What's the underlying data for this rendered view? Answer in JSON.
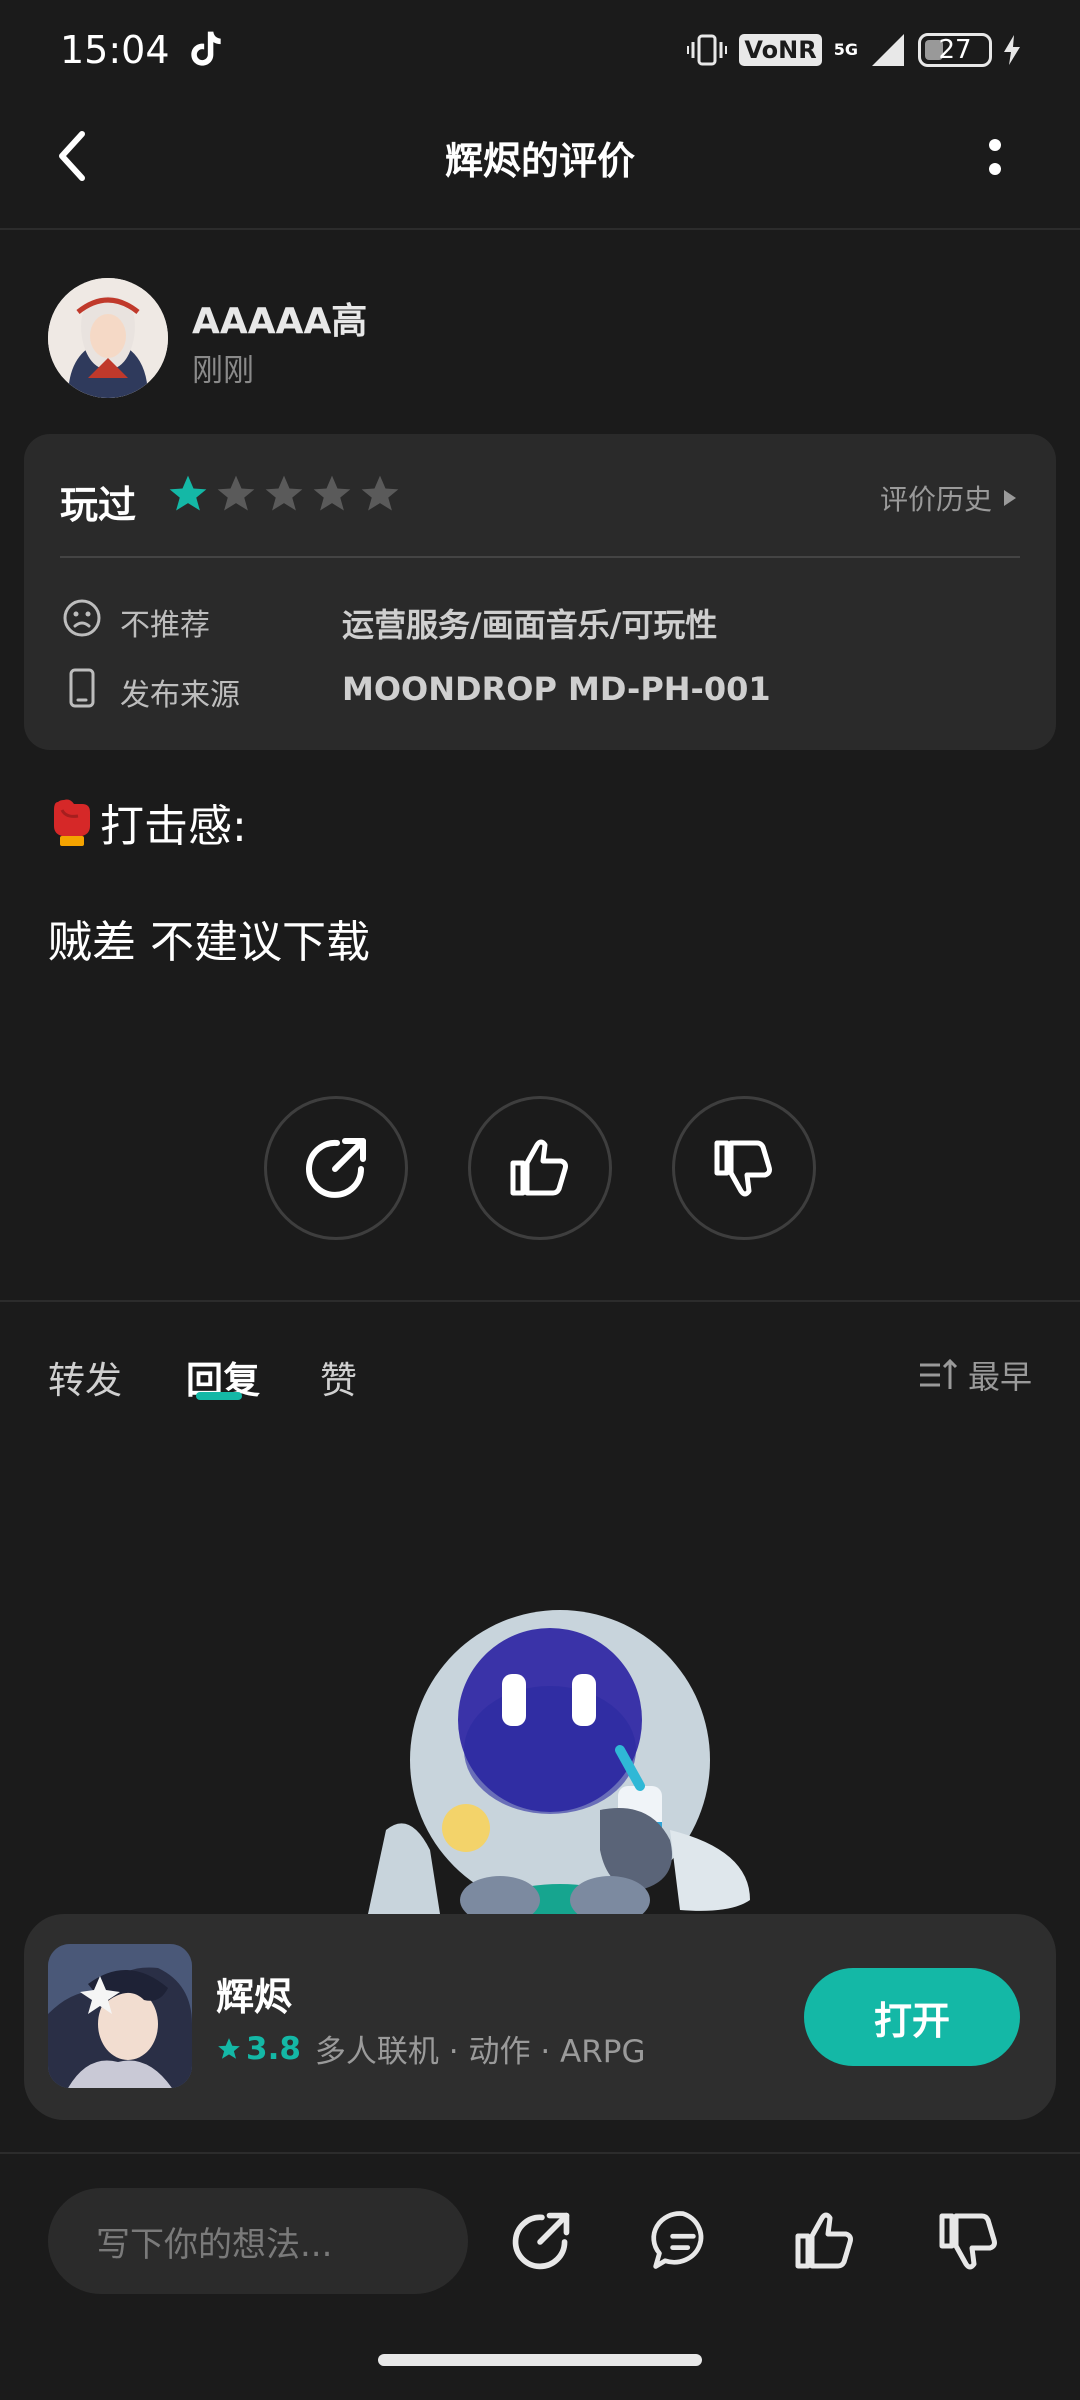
{
  "status_bar": {
    "time": "15:04",
    "network_badge": "VoNR",
    "network_type": "5G",
    "battery": "27"
  },
  "nav": {
    "title": "辉烬的评价"
  },
  "user": {
    "name": "AAAAA高",
    "time": "刚刚"
  },
  "rating_card": {
    "played_label": "玩过",
    "stars_filled": 1,
    "stars_total": 5,
    "history_label": "评价历史",
    "not_recommend_label": "不推荐",
    "not_recommend_value": "运营服务/画面音乐/可玩性",
    "source_label": "发布来源",
    "source_value": "MOONDROP MD-PH-001"
  },
  "review": {
    "subheading": "打击感:",
    "body": "贼差 不建议下载"
  },
  "tabs": {
    "items": [
      "转发",
      "回复",
      "赞"
    ],
    "active": "回复",
    "sort_label": "最早"
  },
  "app": {
    "name": "辉烬",
    "score": "3.8",
    "tags": "多人联机 · 动作 · ARPG",
    "open_label": "打开"
  },
  "bottom_bar": {
    "input_placeholder": "写下你的想法..."
  },
  "colors": {
    "accent": "#14b8a6",
    "background": "#1b1b1b",
    "card": "#2a2a2a"
  }
}
